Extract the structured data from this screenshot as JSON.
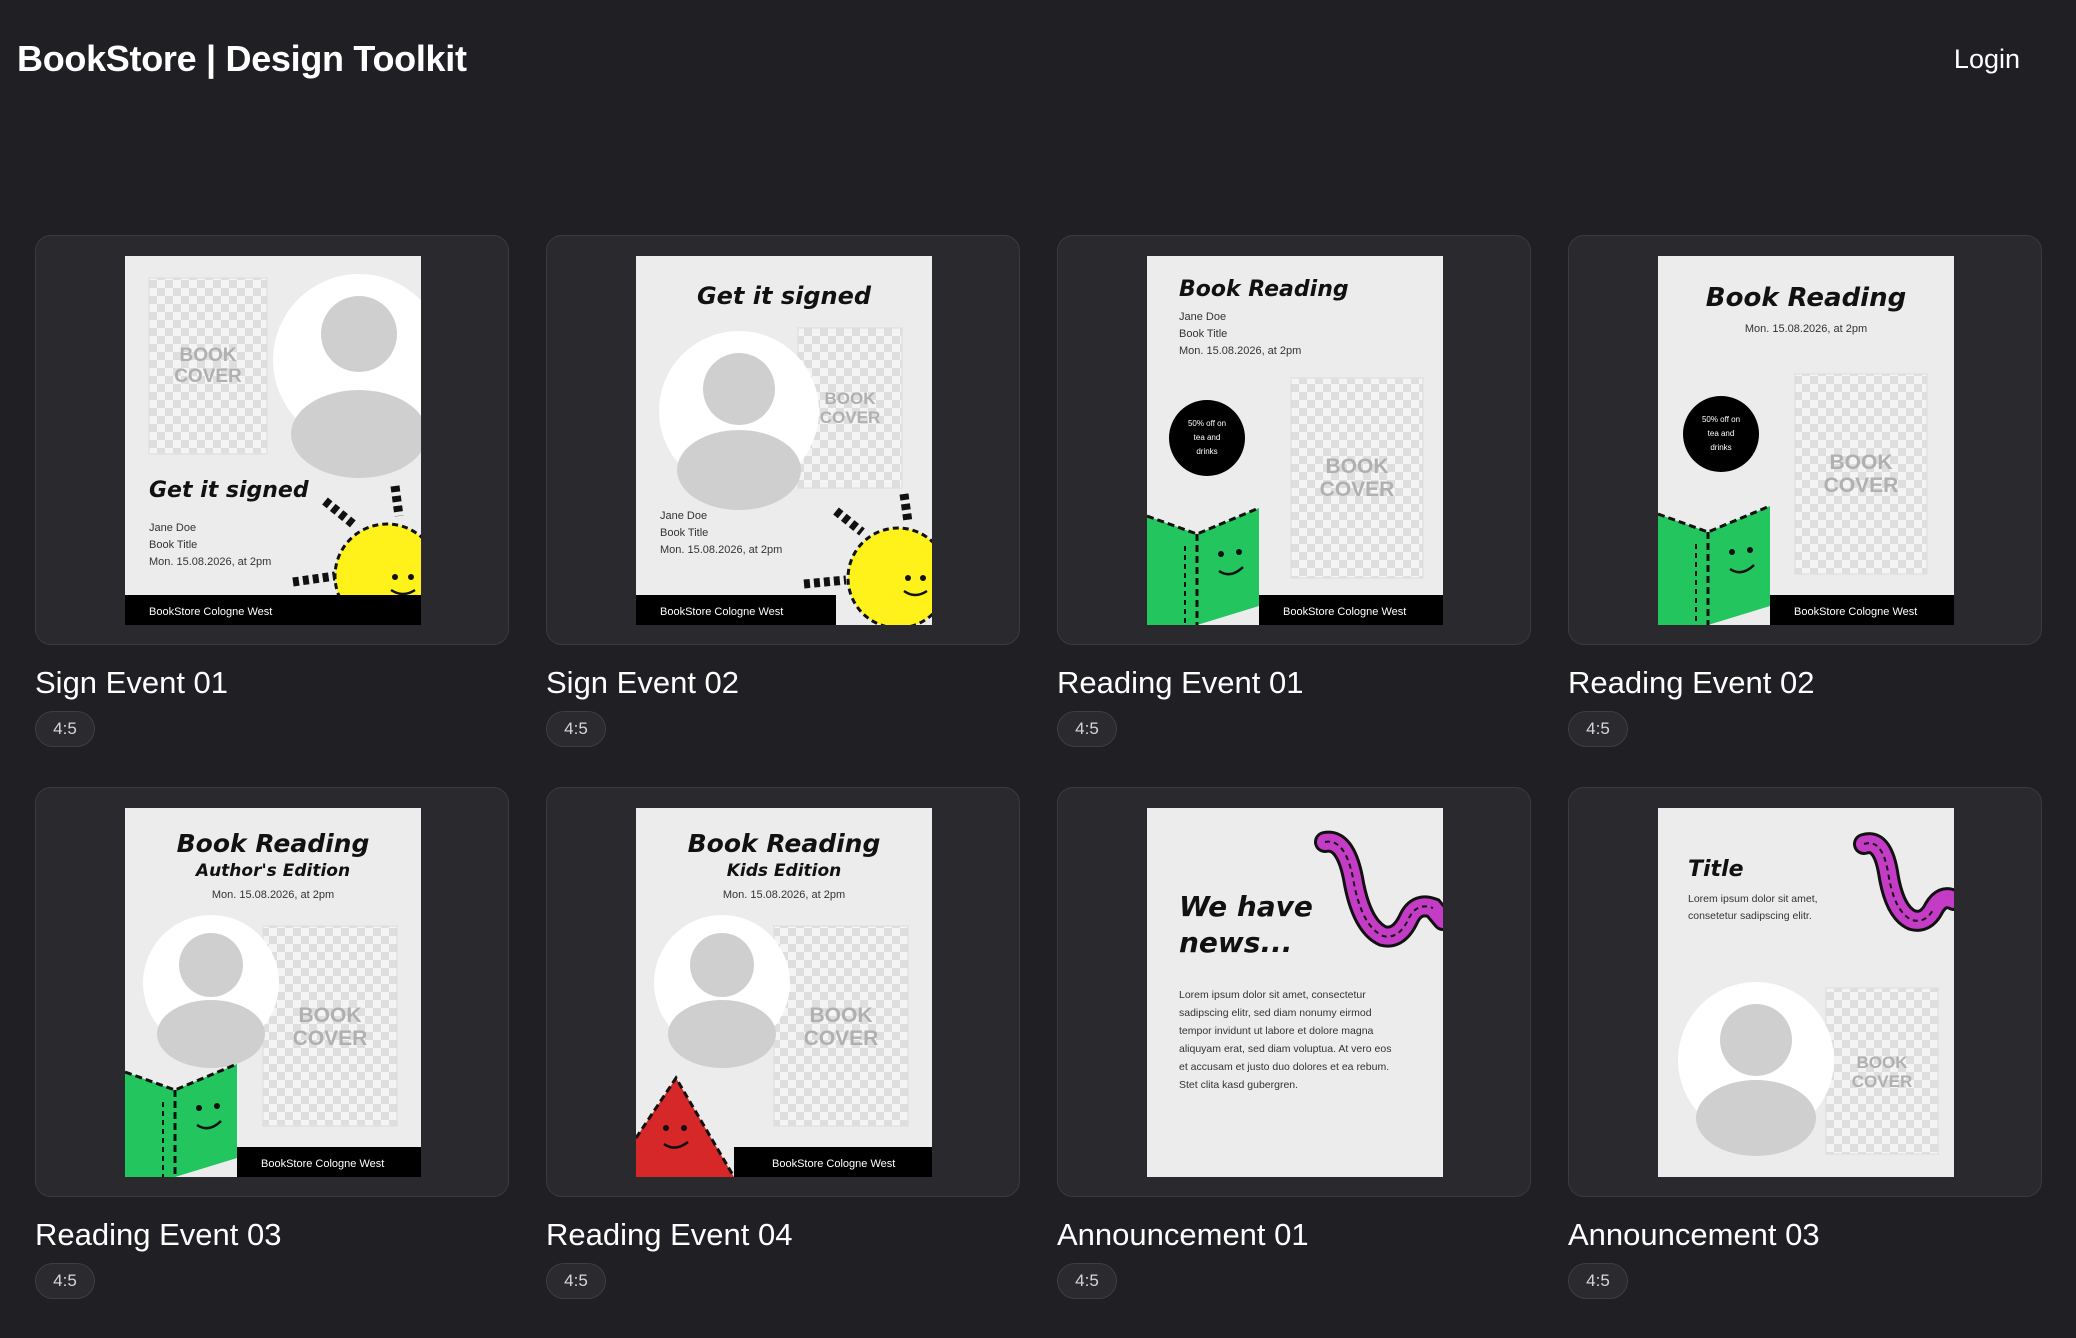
{
  "header": {
    "brand": "BookStore | Design Toolkit",
    "login": "Login"
  },
  "colors": {
    "background": "#202024",
    "card_bg": "#2a2a2e",
    "green": "#22c55e",
    "yellow": "#fff21a",
    "red": "#d62828",
    "magenta": "#c43bc6"
  },
  "templates": [
    {
      "title": "Sign Event 01",
      "ratio": "4:5",
      "poster": {
        "heading": "Get it signed",
        "cover1": "BOOK",
        "cover2": "COVER",
        "line1": "Jane Doe",
        "line2": "Book Title",
        "line3": "Mon. 15.08.2026, at 2pm",
        "footer": "BookStore Cologne West"
      }
    },
    {
      "title": "Sign Event 02",
      "ratio": "4:5",
      "poster": {
        "heading": "Get it signed",
        "cover1": "BOOK",
        "cover2": "COVER",
        "line1": "Jane Doe",
        "line2": "Book Title",
        "line3": "Mon. 15.08.2026, at 2pm",
        "footer": "BookStore Cologne West"
      }
    },
    {
      "title": "Reading Event 01",
      "ratio": "4:5",
      "poster": {
        "heading": "Book Reading",
        "cover1": "BOOK",
        "cover2": "COVER",
        "line1": "Jane Doe",
        "line2": "Book Title",
        "line3": "Mon. 15.08.2026, at 2pm",
        "promo1": "50% off on",
        "promo2": "tea and",
        "promo3": "drinks",
        "footer": "BookStore Cologne West"
      }
    },
    {
      "title": "Reading Event 02",
      "ratio": "4:5",
      "poster": {
        "heading": "Book Reading",
        "cover1": "BOOK",
        "cover2": "COVER",
        "line3": "Mon. 15.08.2026, at 2pm",
        "promo1": "50% off on",
        "promo2": "tea and",
        "promo3": "drinks",
        "footer": "BookStore Cologne West"
      }
    },
    {
      "title": "Reading Event 03",
      "ratio": "4:5",
      "poster": {
        "heading": "Book Reading",
        "subheading": "Author's Edition",
        "cover1": "BOOK",
        "cover2": "COVER",
        "line3": "Mon. 15.08.2026, at 2pm",
        "footer": "BookStore Cologne West"
      }
    },
    {
      "title": "Reading Event 04",
      "ratio": "4:5",
      "poster": {
        "heading": "Book Reading",
        "subheading": "Kids Edition",
        "cover1": "BOOK",
        "cover2": "COVER",
        "line3": "Mon. 15.08.2026, at 2pm",
        "footer": "BookStore Cologne West"
      }
    },
    {
      "title": "Announcement 01",
      "ratio": "4:5",
      "poster": {
        "heading": "We have",
        "heading2": "news...",
        "body1": "Lorem ipsum dolor sit amet, consectetur",
        "body2": "sadipscing elitr, sed diam nonumy eirmod",
        "body3": "tempor invidunt ut labore et dolore magna",
        "body4": "aliquyam erat, sed diam voluptua. At vero eos",
        "body5": "et accusam et justo duo dolores et ea rebum.",
        "body6": "Stet clita kasd gubergren."
      }
    },
    {
      "title": "Announcement 03",
      "ratio": "4:5",
      "poster": {
        "heading": "Title",
        "body1": "Lorem ipsum dolor sit amet,",
        "body2": "consetetur sadipscing elitr.",
        "cover1": "BOOK",
        "cover2": "COVER"
      }
    }
  ]
}
